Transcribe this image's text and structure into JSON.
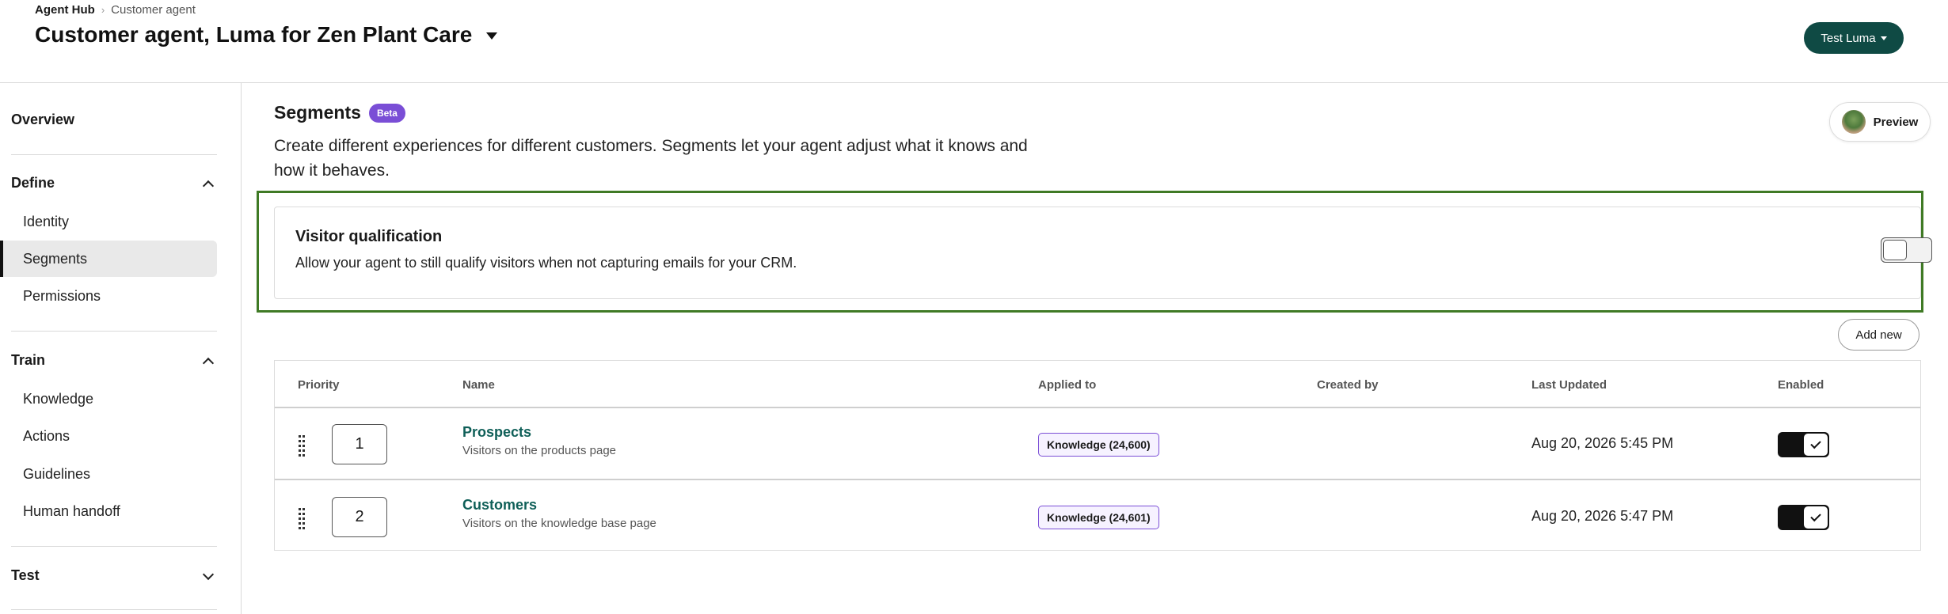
{
  "breadcrumb": {
    "root": "Agent Hub",
    "separator": "›",
    "current": "Customer agent"
  },
  "header": {
    "title": "Customer agent, Luma for Zen Plant Care",
    "test_button": "Test Luma"
  },
  "sidebar": {
    "overview": "Overview",
    "sections": [
      {
        "label": "Define",
        "expanded": true,
        "items": [
          "Identity",
          "Segments",
          "Permissions"
        ]
      },
      {
        "label": "Train",
        "expanded": true,
        "items": [
          "Knowledge",
          "Actions",
          "Guidelines",
          "Human handoff"
        ]
      },
      {
        "label": "Test",
        "expanded": false,
        "items": []
      }
    ],
    "active_item": "Segments"
  },
  "main": {
    "title": "Segments",
    "badge": "Beta",
    "description": "Create different experiences for different customers. Segments let your agent adjust what it knows and how it behaves.",
    "preview_button": "Preview",
    "visitor_qualification": {
      "title": "Visitor qualification",
      "description": "Allow your agent to still qualify visitors when not capturing emails for your CRM.",
      "enabled": false
    },
    "add_new_button": "Add new"
  },
  "table": {
    "columns": [
      "Priority",
      "Name",
      "Applied to",
      "Created by",
      "Last Updated",
      "Enabled"
    ],
    "rows": [
      {
        "priority": "1",
        "name": "Prospects",
        "description": "Visitors on the products page",
        "applied_to": "Knowledge (24,600)",
        "created_by": "",
        "last_updated": "Aug 20, 2026 5:45 PM",
        "enabled": true
      },
      {
        "priority": "2",
        "name": "Customers",
        "description": "Visitors on the knowledge base page",
        "applied_to": "Knowledge (24,601)",
        "created_by": "",
        "last_updated": "Aug 20, 2026 5:47 PM",
        "enabled": true
      }
    ]
  },
  "colors": {
    "brand": "#0f4a44",
    "link": "#0f5f58",
    "beta": "#7a4ed6",
    "highlight": "#3f7a25"
  }
}
